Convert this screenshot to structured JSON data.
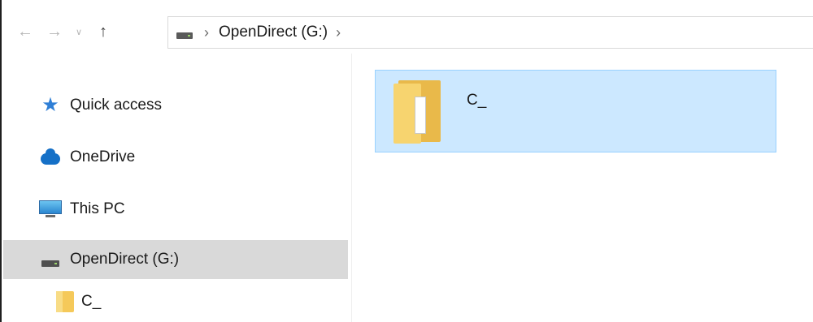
{
  "addressbar": {
    "nav_back": "←",
    "nav_forward": "→",
    "nav_recent": "∨",
    "nav_up": "↑",
    "crumb_sep": "›",
    "crumb_drive": "OpenDirect (G:)",
    "crumb_trailing_sep": "›"
  },
  "sidebar": {
    "items": [
      {
        "label": "Quick access",
        "icon": "star-icon"
      },
      {
        "label": "OneDrive",
        "icon": "cloud-icon"
      },
      {
        "label": "This PC",
        "icon": "computer-icon"
      },
      {
        "label": "OpenDirect (G:)",
        "icon": "drive-icon",
        "selected": true
      },
      {
        "label": "C_",
        "icon": "folder-icon"
      }
    ]
  },
  "content": {
    "items": [
      {
        "label": "C_",
        "icon": "folder-icon",
        "selected": true
      }
    ]
  },
  "colors": {
    "selection_bg": "#cce8ff",
    "selection_border": "#99d1ff",
    "nav_selected_bg": "#d9d9d9",
    "star": "#2f7fd6",
    "cloud": "#1570c7"
  }
}
